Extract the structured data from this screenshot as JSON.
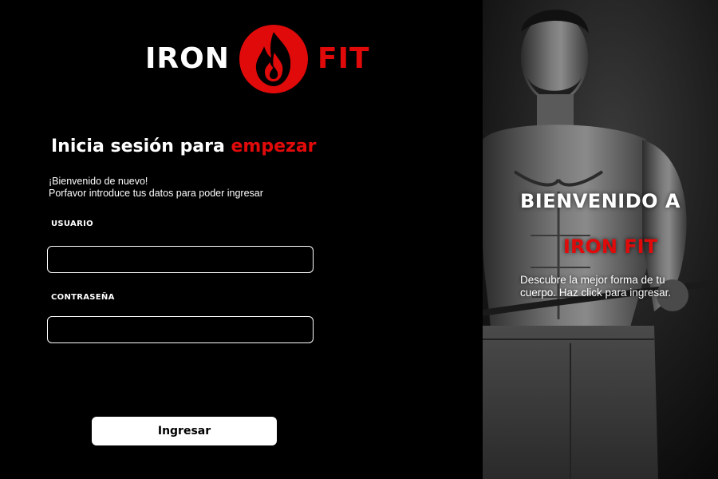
{
  "brand": {
    "word_left": "IRON",
    "word_right": "FIT",
    "logo_icon": "flame-icon",
    "accent_color": "#e10a0a"
  },
  "login": {
    "title_main": "Inicia sesión para ",
    "title_accent": "empezar",
    "welcome_line": "¡Bienvenido de nuevo!",
    "instruction_line": "Porfavor introduce tus datos para poder ingresar",
    "username_label": "USUARIO",
    "username_value": "",
    "password_label": "CONTRASEÑA",
    "password_value": "",
    "submit_label": "Ingresar"
  },
  "hero": {
    "title": "BIENVENIDO A",
    "brand": "IRON FIT",
    "description": "Descubre la mejor forma de tu cuerpo. Haz click para ingresar.",
    "image": "athlete-photo"
  }
}
